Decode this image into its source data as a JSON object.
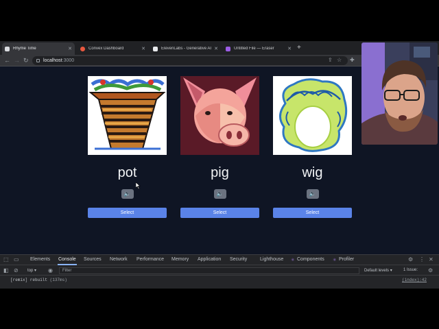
{
  "tabs": [
    {
      "title": "Rhyme Time",
      "favicon_color": "#dadce0",
      "active": true
    },
    {
      "title": "Convex Dashboard",
      "favicon_color": "#e8583f",
      "active": false
    },
    {
      "title": "ElevenLabs - Generative AI Te...",
      "favicon_color": "#e8eaed",
      "active": false
    },
    {
      "title": "Untitled File — Eraser",
      "favicon_color": "#9b5de5",
      "active": false
    }
  ],
  "address": {
    "host": "localhost",
    "port": ":3000"
  },
  "cards": [
    {
      "word": "pot",
      "image": "pot-drawing",
      "select_label": "Select"
    },
    {
      "word": "pig",
      "image": "pig-drawing",
      "select_label": "Select"
    },
    {
      "word": "wig",
      "image": "wig-drawing",
      "select_label": "Select"
    }
  ],
  "devtools": {
    "tabs": [
      "Elements",
      "Console",
      "Sources",
      "Network",
      "Performance",
      "Memory",
      "Application",
      "Security",
      "Lighthouse",
      "Components",
      "Profiler"
    ],
    "active_tab": "Console",
    "context": "top",
    "filter_placeholder": "Filter",
    "levels": "Default levels",
    "issues": "1 Issue:",
    "log": {
      "message": "[remix] rebuilt",
      "time": "(137ms)",
      "source": "(index):42"
    }
  },
  "colors": {
    "page_bg": "#0f1524",
    "button_blue": "#5a83e8",
    "speaker_bg": "#6b7280"
  }
}
